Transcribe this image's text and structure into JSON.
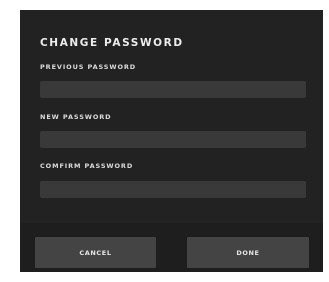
{
  "dialog": {
    "title": "CHANGE PASSWORD",
    "fields": [
      {
        "label": "PREVIOUS PASSWORD",
        "value": "",
        "placeholder": ""
      },
      {
        "label": "NEW PASSWORD",
        "value": "",
        "placeholder": ""
      },
      {
        "label": "COMFIRM PASSWORD",
        "value": "",
        "placeholder": ""
      }
    ],
    "buttons": {
      "cancel_label": "CANCEL",
      "done_label": "DONE"
    }
  },
  "colors": {
    "dialog_background": "#222222",
    "input_background": "#393939",
    "footer_background": "#1e1e1e",
    "button_background": "#444444",
    "text": "#e6e6e6"
  }
}
